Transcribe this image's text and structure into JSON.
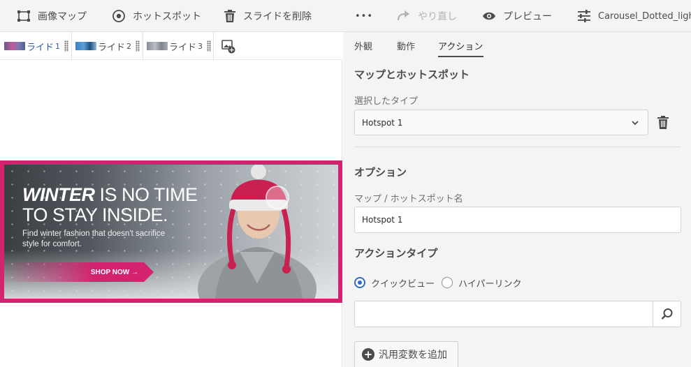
{
  "toolbar": {
    "image_map": "画像マップ",
    "hotspot": "ホットスポット",
    "delete_slide": "スライドを削除",
    "more": "•••",
    "redo": "やり直し",
    "preview": "プレビュー",
    "preset_name": "Carousel_Dotted_light"
  },
  "slides": [
    {
      "label": "ライド",
      "number": "1",
      "active": true
    },
    {
      "label": "ライド",
      "number": "2",
      "active": false
    },
    {
      "label": "ライド",
      "number": "3",
      "active": false
    }
  ],
  "banner": {
    "headline_bold": "WINTER",
    "headline_rest": " IS NO TIME",
    "headline_line2": "TO STAY INSIDE.",
    "subtext": "Find winter fashion that doesn't sacrifice style for comfort.",
    "cta": "SHOP NOW →",
    "accent_color": "#d4226f"
  },
  "panel": {
    "tabs": [
      "外観",
      "動作",
      "アクション"
    ],
    "active_tab": "アクション",
    "map_hotspot_heading": "マップとホットスポット",
    "selected_type_label": "選択したタイプ",
    "selected_type_value": "Hotspot 1",
    "options_heading": "オプション",
    "name_label": "マップ / ホットスポット名",
    "name_value": "Hotspot 1",
    "action_type_heading": "アクションタイプ",
    "action_types": [
      "クイックビュー",
      "ハイパーリンク"
    ],
    "selected_action_type": "クイックビュー",
    "search_value": "",
    "add_variable": "汎用変数を追加"
  },
  "colors": {
    "selected_radio": "#2c6bc9",
    "link_text": "#2c5aa0"
  }
}
